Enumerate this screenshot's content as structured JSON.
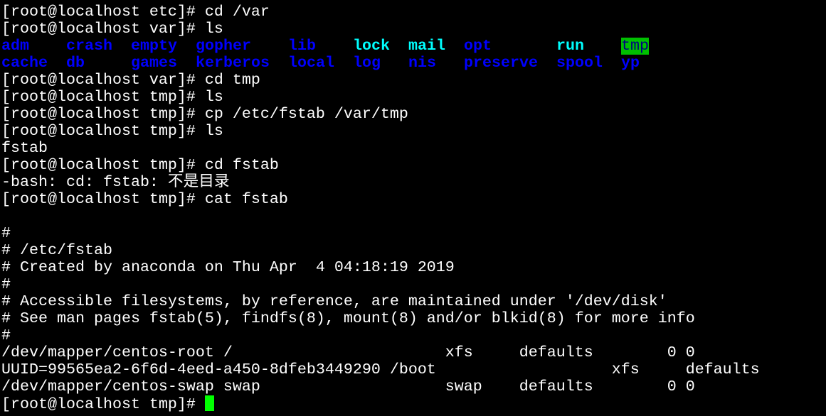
{
  "terminal": {
    "lines_before": [
      "[root@localhost etc]# cd /var",
      "[root@localhost var]# ls"
    ],
    "ls_rows": [
      [
        {
          "name": "adm",
          "col": 0,
          "style": "blue"
        },
        {
          "name": "crash",
          "col": 7,
          "style": "blue"
        },
        {
          "name": "empty",
          "col": 14,
          "style": "blue"
        },
        {
          "name": "gopher",
          "col": 21,
          "style": "blue"
        },
        {
          "name": "lib",
          "col": 31,
          "style": "blue"
        },
        {
          "name": "lock",
          "col": 38,
          "style": "cyan"
        },
        {
          "name": "mail",
          "col": 44,
          "style": "cyan"
        },
        {
          "name": "opt",
          "col": 50,
          "style": "blue"
        },
        {
          "name": "run",
          "col": 60,
          "style": "cyan"
        },
        {
          "name": "tmp",
          "col": 67,
          "style": "tmpdir"
        }
      ],
      [
        {
          "name": "cache",
          "col": 0,
          "style": "blue"
        },
        {
          "name": "db",
          "col": 7,
          "style": "blue"
        },
        {
          "name": "games",
          "col": 14,
          "style": "blue"
        },
        {
          "name": "kerberos",
          "col": 21,
          "style": "blue"
        },
        {
          "name": "local",
          "col": 31,
          "style": "blue"
        },
        {
          "name": "log",
          "col": 38,
          "style": "blue"
        },
        {
          "name": "nis",
          "col": 44,
          "style": "blue"
        },
        {
          "name": "preserve",
          "col": 50,
          "style": "blue"
        },
        {
          "name": "spool",
          "col": 60,
          "style": "blue"
        },
        {
          "name": "yp",
          "col": 67,
          "style": "blue"
        }
      ]
    ],
    "lines_after": [
      "[root@localhost var]# cd tmp",
      "[root@localhost tmp]# ls",
      "[root@localhost tmp]# cp /etc/fstab /var/tmp",
      "[root@localhost tmp]# ls",
      "fstab",
      "[root@localhost tmp]# cd fstab",
      "-bash: cd: fstab: 不是目录",
      "[root@localhost tmp]# cat fstab",
      "",
      "#",
      "# /etc/fstab",
      "# Created by anaconda on Thu Apr  4 04:18:19 2019",
      "#",
      "# Accessible filesystems, by reference, are maintained under '/dev/disk'",
      "# See man pages fstab(5), findfs(8), mount(8) and/or blkid(8) for more info",
      "#",
      "/dev/mapper/centos-root /                       xfs     defaults        0 0",
      "UUID=99565ea2-6f6d-4eed-a450-8dfeb3449290 /boot                   xfs     defaults",
      "/dev/mapper/centos-swap swap                    swap    defaults        0 0"
    ],
    "prompt": "[root@localhost tmp]# ",
    "colors": {
      "background": "#000000",
      "text": "#ffffff",
      "directory": "#0000ff",
      "cyan": "#00ffff",
      "highlight_bg": "#00c000",
      "cursor": "#00ff00"
    }
  }
}
